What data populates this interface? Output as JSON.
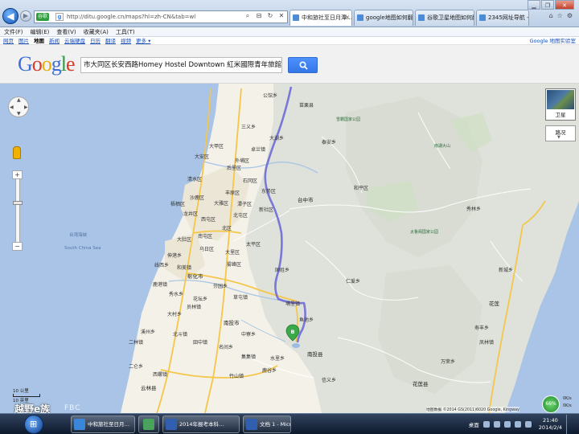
{
  "browser": {
    "address_badge": "谷歌",
    "url": "http://ditu.google.cn/maps?hl=zh-CN&tab=wl",
    "tabs": [
      {
        "label": "中和旅社至日月潭…",
        "active": true
      },
      {
        "label": "google地图如何翻…",
        "active": false
      },
      {
        "label": "谷歌卫星地图如何翻…",
        "active": false
      },
      {
        "label": "2345网址导航 - 开创…",
        "active": false
      }
    ],
    "menu": [
      "文件(F)",
      "编辑(E)",
      "查看(V)",
      "收藏夹(A)",
      "工具(T)"
    ]
  },
  "google_nav": {
    "links": [
      {
        "label": "网页",
        "active": false
      },
      {
        "label": "图片",
        "active": false
      },
      {
        "label": "地图",
        "active": true
      },
      {
        "label": "新闻",
        "active": false
      },
      {
        "label": "云端硬盘",
        "active": false
      },
      {
        "label": "日历",
        "active": false
      },
      {
        "label": "翻译",
        "active": false
      },
      {
        "label": "视频",
        "active": false
      },
      {
        "label": "更多 ▾",
        "active": false
      }
    ],
    "right_link": "Google 地图实验室"
  },
  "search": {
    "logo": "Google",
    "value": "市大同区长安西路Homey Hostel Downtown 紅米國際青年旅館"
  },
  "map": {
    "places": [
      {
        "name": "苗栗县"
      },
      {
        "name": "公馆乡"
      },
      {
        "name": "三义乡"
      },
      {
        "name": "大湖乡"
      },
      {
        "name": "卓兰镇"
      },
      {
        "name": "泰安乡"
      },
      {
        "name": "后里区"
      },
      {
        "name": "东势区"
      },
      {
        "name": "石冈区"
      },
      {
        "name": "新社区"
      },
      {
        "name": "台中市"
      },
      {
        "name": "和平区"
      },
      {
        "name": "大甲区"
      },
      {
        "name": "外埔区"
      },
      {
        "name": "大安区"
      },
      {
        "name": "清水区"
      },
      {
        "name": "丰原区"
      },
      {
        "name": "沙鹿区"
      },
      {
        "name": "梧栖区"
      },
      {
        "name": "大雅区"
      },
      {
        "name": "潭子区"
      },
      {
        "name": "龙井区"
      },
      {
        "name": "西屯区"
      },
      {
        "name": "北屯区"
      },
      {
        "name": "北区"
      },
      {
        "name": "南屯区"
      },
      {
        "name": "太平区"
      },
      {
        "name": "大肚区"
      },
      {
        "name": "乌日区"
      },
      {
        "name": "大里区"
      },
      {
        "name": "雾峰区"
      },
      {
        "name": "伸港乡"
      },
      {
        "name": "和美镇"
      },
      {
        "name": "彰化市"
      },
      {
        "name": "线西乡"
      },
      {
        "name": "鹿港镇"
      },
      {
        "name": "芬园乡"
      },
      {
        "name": "秀水乡"
      },
      {
        "name": "花坛乡"
      },
      {
        "name": "国姓乡"
      },
      {
        "name": "草屯镇"
      },
      {
        "name": "员林镇"
      },
      {
        "name": "大村乡"
      },
      {
        "name": "南投市"
      },
      {
        "name": "埔里镇"
      },
      {
        "name": "鱼池乡"
      },
      {
        "name": "水里乡"
      },
      {
        "name": "集集镇"
      },
      {
        "name": "竹山镇"
      },
      {
        "name": "鹿谷乡"
      },
      {
        "name": "南投县"
      },
      {
        "name": "信义乡"
      },
      {
        "name": "仁爱乡"
      },
      {
        "name": "中寮乡"
      },
      {
        "name": "名间乡"
      },
      {
        "name": "溪州乡"
      },
      {
        "name": "二林镇"
      },
      {
        "name": "北斗镇"
      },
      {
        "name": "田中镇"
      },
      {
        "name": "云林县"
      },
      {
        "name": "西螺镇"
      },
      {
        "name": "二仑乡"
      },
      {
        "name": "秀林乡"
      },
      {
        "name": "花莲县"
      },
      {
        "name": "花莲"
      },
      {
        "name": "万荣乡"
      },
      {
        "name": "凤林镇"
      },
      {
        "name": "南湖大山"
      },
      {
        "name": "雪霸国家公园"
      },
      {
        "name": "太鲁阁国家公园"
      },
      {
        "name": "台湾海峡"
      },
      {
        "name": "South China Sea"
      },
      {
        "name": "新城乡"
      },
      {
        "name": "寿丰乡"
      }
    ],
    "route_marker": "B"
  },
  "controls": {
    "pan_arrows": [
      "▲",
      "◀",
      "▶",
      "▼"
    ],
    "zoom_in": "+",
    "zoom_out": "−",
    "satellite": "卫星",
    "traffic": "路况",
    "traffic_arrow": "▼"
  },
  "scale": {
    "top": "10 公里",
    "bottom": "10 英里"
  },
  "copyright": "地图数据 ©2014 GS(2011)6020 Google, Kingway",
  "watermark": {
    "brand": "越野e族",
    "site": "FBC"
  },
  "speed_widget": {
    "percent": "66%",
    "up": "0K/s",
    "down": "0K/s"
  },
  "taskbar": {
    "items": [
      {
        "label": "中和旅社至日月…"
      },
      {
        "label": ""
      },
      {
        "label": "2014年报考本科…"
      },
      {
        "label": "文档 1 - Micros…"
      }
    ],
    "tray_label": "桌面",
    "time": "21:40",
    "date": "2014/2/4"
  },
  "colors": {
    "route": "#6e6bd6",
    "water": "#a9c4e6",
    "plain": "#f4f1e8",
    "mountain": "#dfe2da",
    "road_major": "#f4c64a",
    "road_minor": "#ffffff",
    "brand_blue": "#4d90fe"
  }
}
